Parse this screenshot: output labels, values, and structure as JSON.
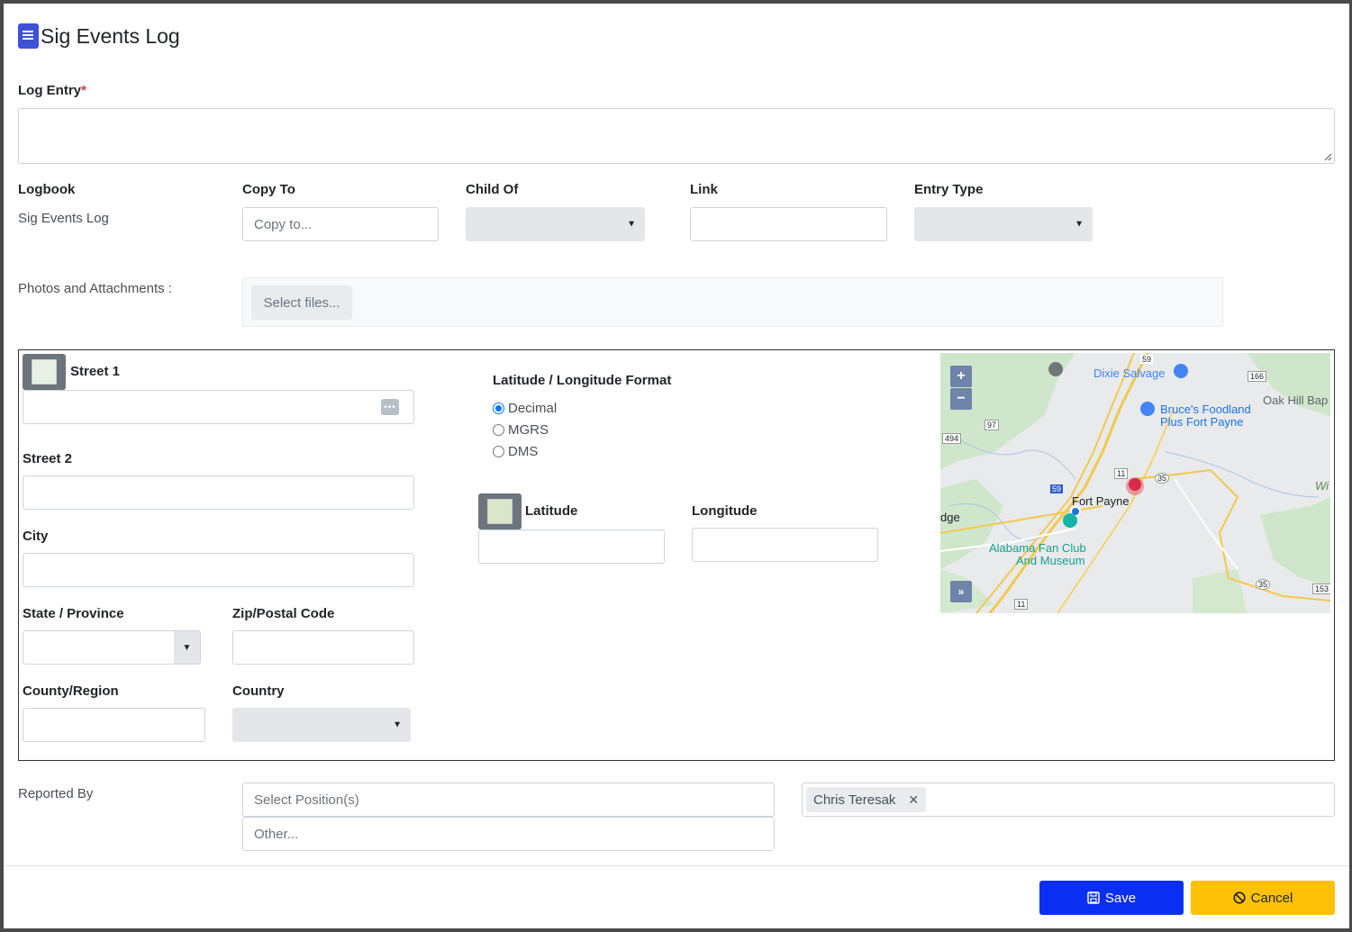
{
  "dialog": {
    "title": "Sig Events Log",
    "title_icon": "book-icon"
  },
  "log_entry": {
    "label": "Log Entry",
    "required_mark": "*",
    "value": ""
  },
  "fields": {
    "logbook_label": "Logbook",
    "logbook_value": "Sig Events Log",
    "copy_to_label": "Copy To",
    "copy_to_placeholder": "Copy to...",
    "child_of_label": "Child Of",
    "child_of_value": "",
    "link_label": "Link",
    "link_value": "",
    "entry_type_label": "Entry Type",
    "entry_type_value": ""
  },
  "attachments": {
    "label": "Photos and Attachments :",
    "select_button": "Select files..."
  },
  "address": {
    "street1_label": "Street 1",
    "street2_label": "Street 2",
    "city_label": "City",
    "state_label": "State / Province",
    "zip_label": "Zip/Postal Code",
    "county_label": "County/Region",
    "country_label": "Country",
    "latlon_format_label": "Latitude / Longitude Format",
    "formats": [
      {
        "label": "Decimal",
        "selected": true
      },
      {
        "label": "MGRS",
        "selected": false
      },
      {
        "label": "DMS",
        "selected": false
      }
    ],
    "latitude_label": "Latitude",
    "longitude_label": "Longitude"
  },
  "map": {
    "zoom_in": "+",
    "zoom_out": "−",
    "expand": "»",
    "labels": {
      "dixie": "Dixie Salvage",
      "bruces1": "Bruce's Foodland",
      "bruces2": "Plus Fort Payne",
      "oakhill": "Oak Hill Bap",
      "fortpayne": "Fort Payne",
      "alabama1": "Alabama Fan Club",
      "alabama2": "And Museum",
      "dge": "dge",
      "wi": "Wi"
    },
    "shields": {
      "s59": "59",
      "s166": "166",
      "s97": "97",
      "s494": "494",
      "s11a": "11",
      "s35a": "35",
      "s59b": "59",
      "s35b": "35",
      "s153": "153",
      "s11b": "11"
    }
  },
  "reported_by": {
    "label": "Reported By",
    "positions_placeholder": "Select Position(s)",
    "other_placeholder": "Other...",
    "person": "Chris Teresak",
    "remove_symbol": "✕"
  },
  "footer": {
    "save_label": "Save",
    "cancel_label": "Cancel"
  },
  "colors": {
    "save": "#0b2ff2",
    "cancel": "#ffc107",
    "required": "#dc3545"
  }
}
